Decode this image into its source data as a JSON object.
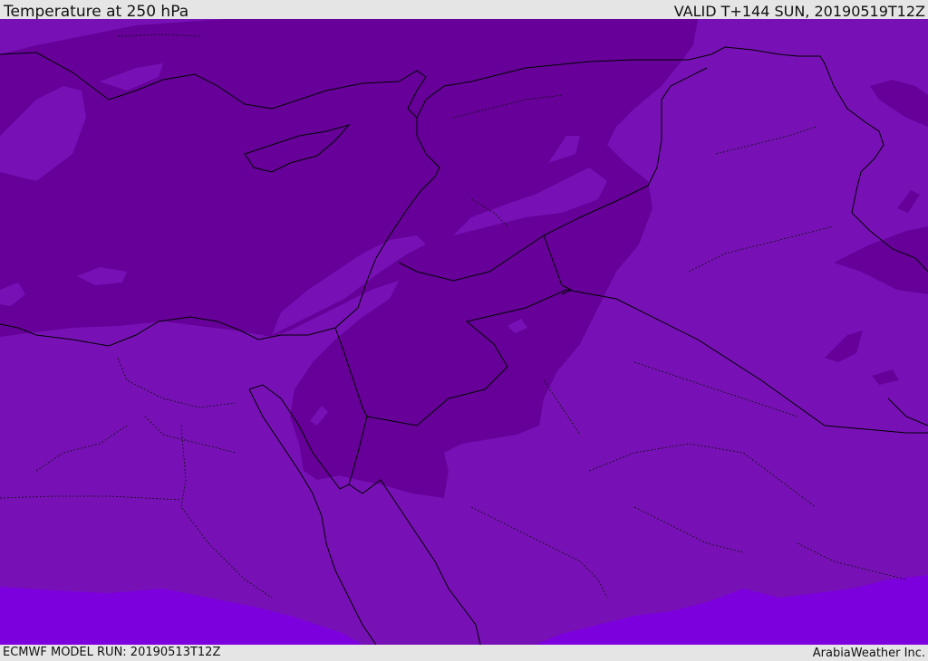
{
  "header": {
    "title": "Temperature at 250 hPa",
    "valid": "VALID T+144 SUN, 20190519T12Z"
  },
  "footer": {
    "model_run": "ECMWF MODEL RUN: 20190513T12Z",
    "credit": "ArabiaWeather Inc."
  },
  "colors": {
    "coldest": "#660099",
    "cold": "#7711b5",
    "warmer": "#7c00dd",
    "coast": "#000000"
  }
}
